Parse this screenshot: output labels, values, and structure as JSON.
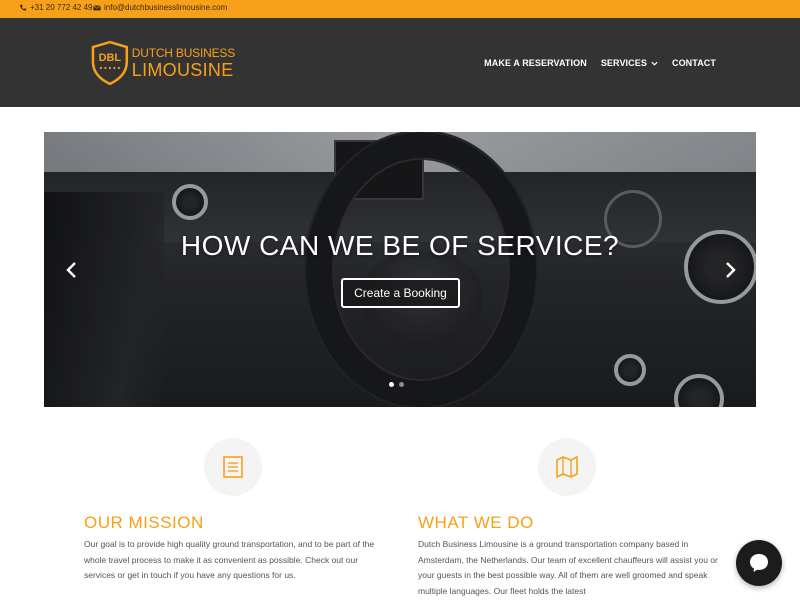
{
  "topbar": {
    "phone": "+31 20 772 42 49",
    "email": "info@dutchbusinesslimousine.com",
    "color": "#f7a11a"
  },
  "header": {
    "logo": {
      "badge_text": "DBL",
      "line1": "DUTCH BUSINESS",
      "line2": "LIMOUSINE"
    },
    "nav": [
      {
        "label": "MAKE A RESERVATION"
      },
      {
        "label": "SERVICES",
        "has_dropdown": true
      },
      {
        "label": "CONTACT"
      }
    ],
    "background": "#333333"
  },
  "slider": {
    "headline": "HOW CAN WE BE OF SERVICE?",
    "cta_label": "Create a Booking",
    "prev_icon": "chevron-left-icon",
    "next_icon": "chevron-right-icon",
    "slide_count": 2,
    "active_slide": 1
  },
  "features": [
    {
      "icon": "document-list-icon",
      "title": "OUR MISSION",
      "text": "Our goal is to provide high quality ground transportation, and to be part of the whole travel process to make it as convenient as possible. Check out our services or get in touch if you have any questions for us."
    },
    {
      "icon": "map-icon",
      "title": "WHAT WE DO",
      "text": "Dutch Business Limousine is a ground transportation company based in Amsterdam, the Netherlands. Our team of excellent chauffeurs will assist you or your guests in the best possible way. All of them are well groomed and speak multiple languages. Our fleet holds the latest"
    }
  ],
  "chat": {
    "icon": "chat-bubble-icon"
  },
  "accent_color": "#f7a11a"
}
